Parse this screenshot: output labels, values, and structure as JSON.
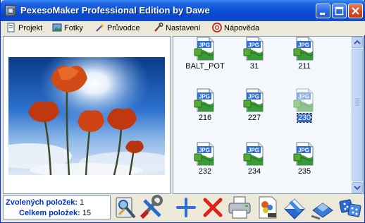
{
  "window": {
    "title": "PexesoMaker Professional Edition by Dawe"
  },
  "menu": [
    {
      "label": "Projekt",
      "icon": "project-icon"
    },
    {
      "label": "Fotky",
      "icon": "photos-icon"
    },
    {
      "label": "Průvodce",
      "icon": "wizard-icon"
    },
    {
      "label": "Nastavení",
      "icon": "settings-icon"
    },
    {
      "label": "Nápověda",
      "icon": "help-icon"
    }
  ],
  "thumbnails": [
    {
      "name": "BALT_POT",
      "selected": false
    },
    {
      "name": "31",
      "selected": false
    },
    {
      "name": "211",
      "selected": false
    },
    {
      "name": "216",
      "selected": false
    },
    {
      "name": "227",
      "selected": false
    },
    {
      "name": "230",
      "selected": true
    },
    {
      "name": "232",
      "selected": false
    },
    {
      "name": "234",
      "selected": false
    },
    {
      "name": "235",
      "selected": false
    }
  ],
  "file_badge": "JPG",
  "status": {
    "selected_label": "Zvolených položek:",
    "selected_value": "1",
    "total_label": "Celkem položek:",
    "total_value": "15"
  },
  "toolbar": [
    "view-icon",
    "tools-icon",
    "add-icon",
    "delete-icon",
    "print-icon",
    "image-icon",
    "export-icon",
    "save-icon",
    "game-icon"
  ],
  "colors": {
    "titlebar": "#0b4fd6",
    "status_label": "#0033cc",
    "selection": "#316ac5"
  }
}
